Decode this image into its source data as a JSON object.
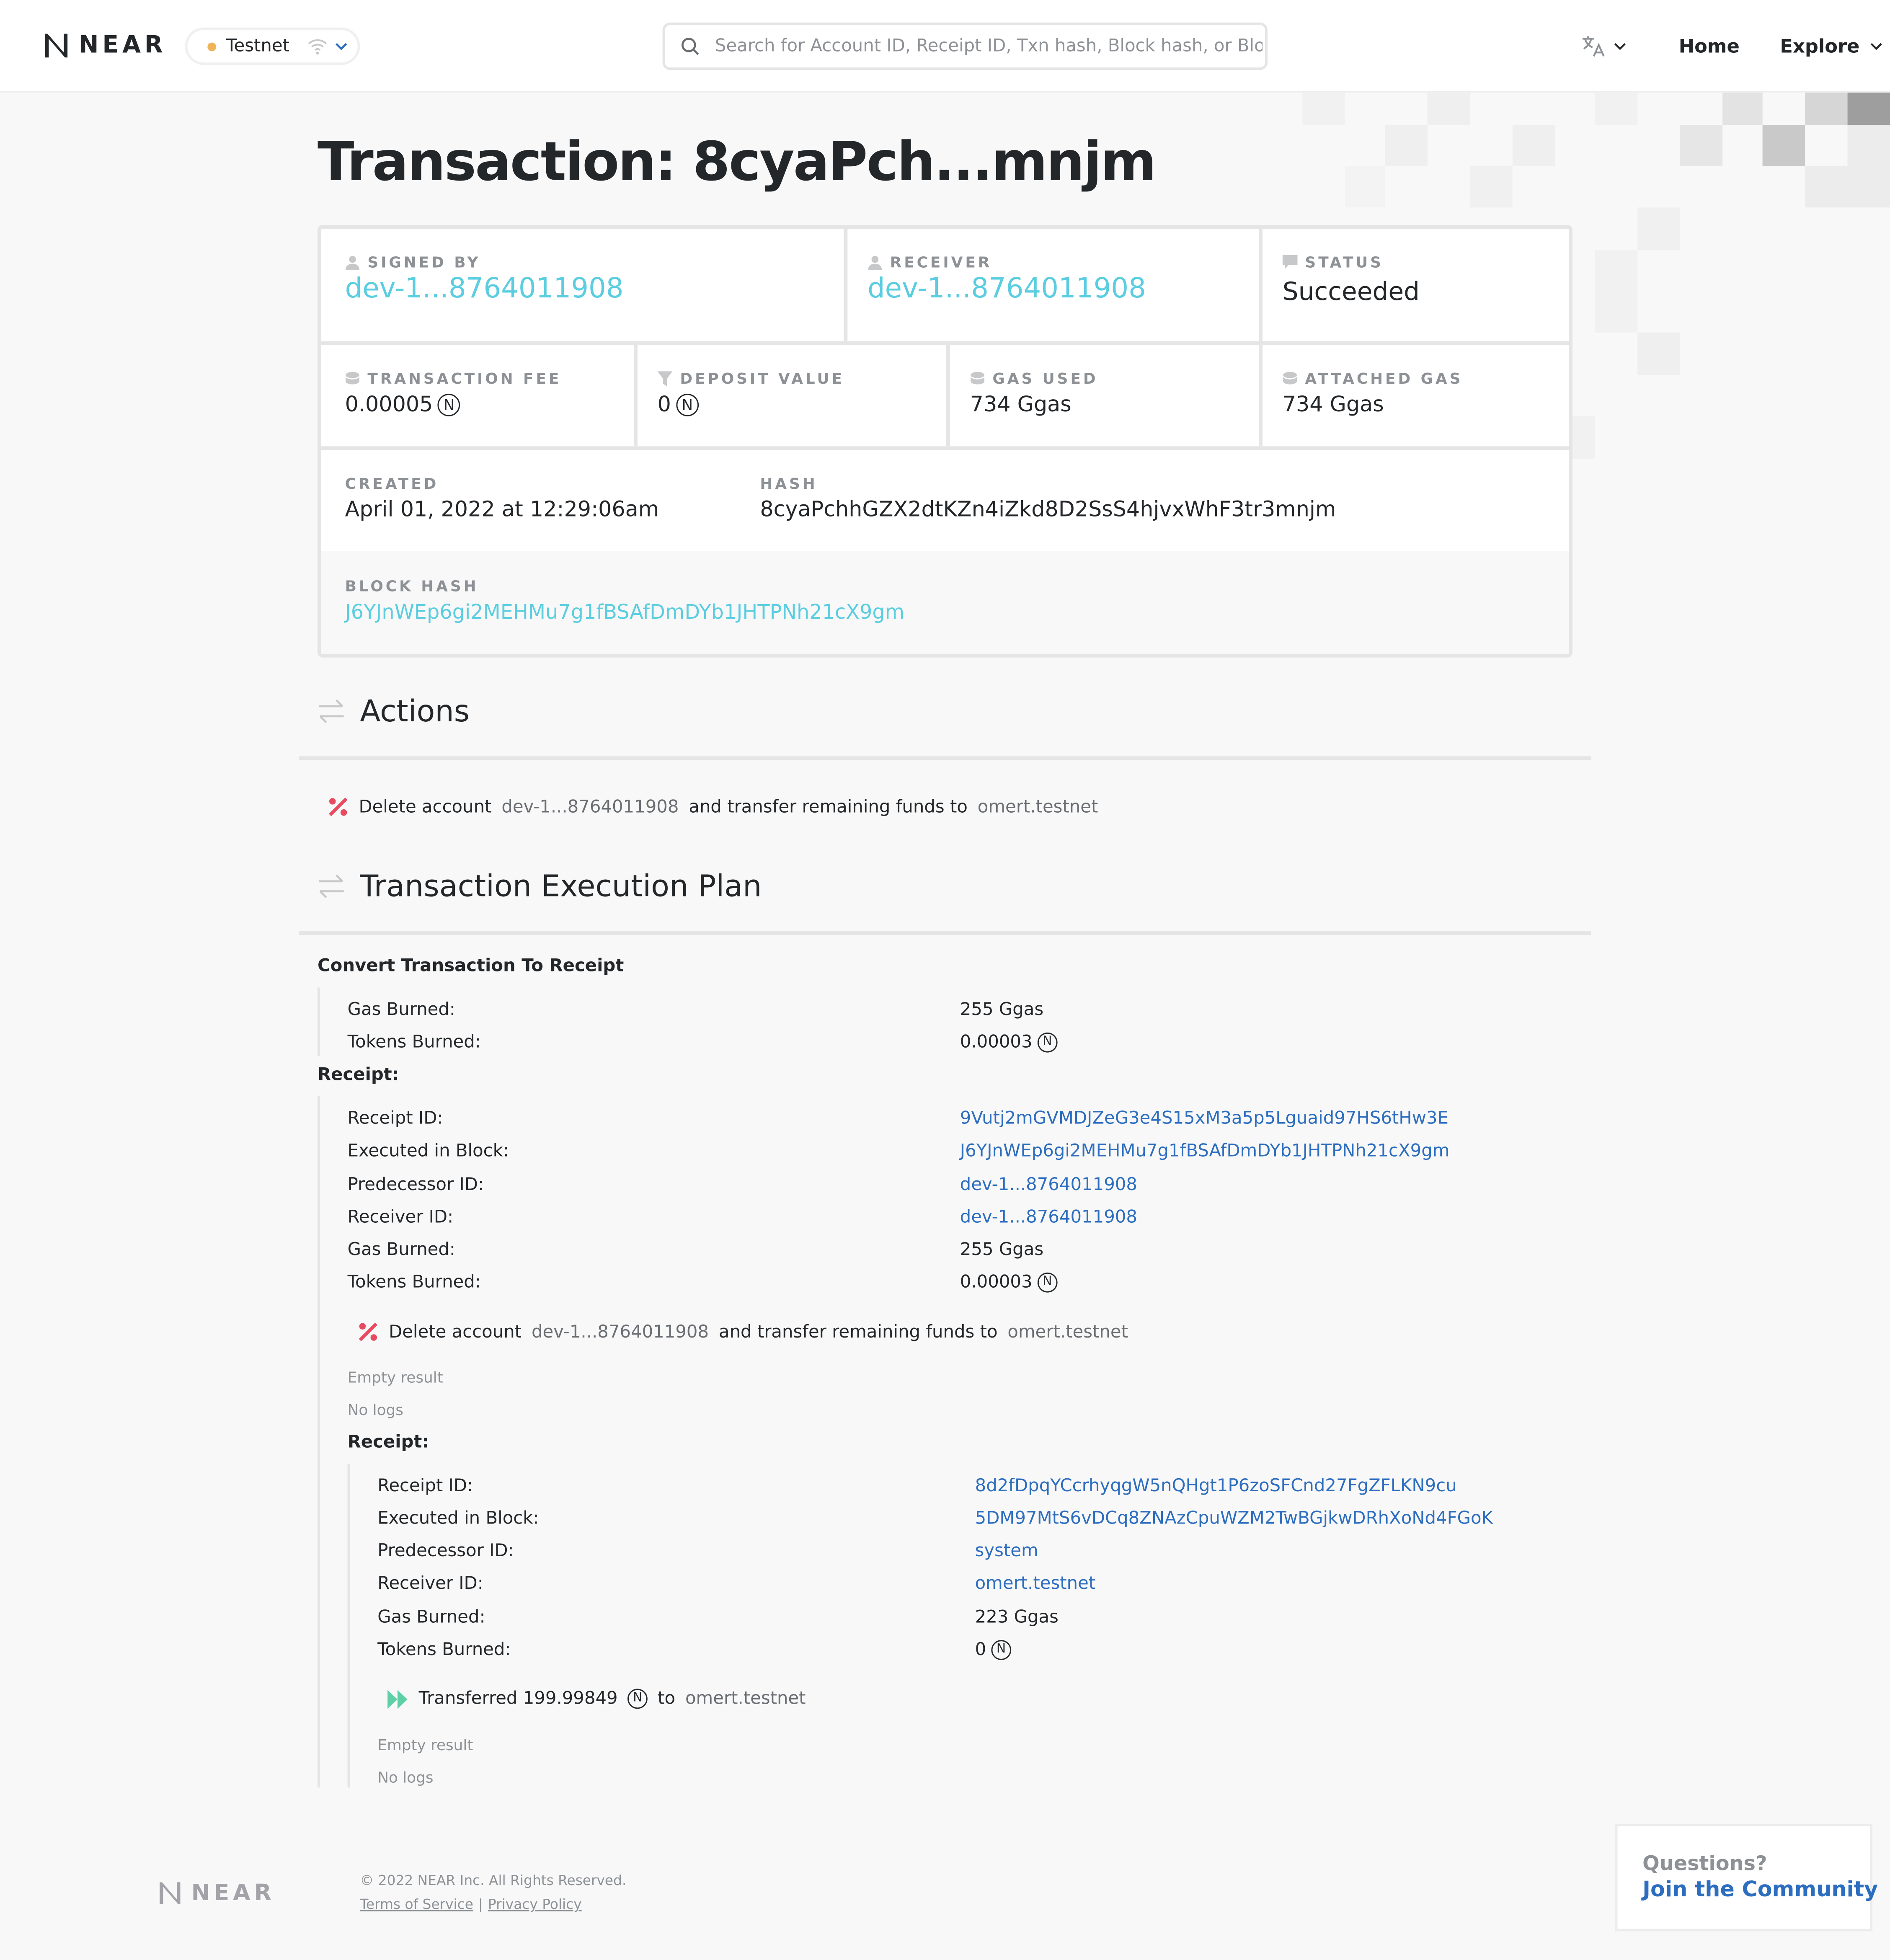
{
  "header": {
    "brand": "NEAR",
    "network": "Testnet",
    "search_placeholder": "Search for Account ID, Receipt ID, Txn hash, Block hash, or Block height",
    "nav_home": "Home",
    "nav_explore": "Explore"
  },
  "page": {
    "title": "Transaction: 8cyaPch...mnjm"
  },
  "summary": {
    "signed_by_label": "SIGNED BY",
    "signed_by": "dev-1...8764011908",
    "receiver_label": "RECEIVER",
    "receiver": "dev-1...8764011908",
    "status_label": "STATUS",
    "status": "Succeeded",
    "fee_label": "TRANSACTION FEE",
    "fee": "0.00005",
    "deposit_label": "DEPOSIT VALUE",
    "deposit": "0",
    "gas_used_label": "GAS USED",
    "gas_used": "734 Ggas",
    "attached_gas_label": "ATTACHED GAS",
    "attached_gas": "734 Ggas",
    "created_label": "CREATED",
    "created": "April 01, 2022 at 12:29:06am",
    "hash_label": "HASH",
    "hash": "8cyaPchhGZX2dtKZn4iZkd8D2SsS4hjvxWhF3tr3mnjm",
    "block_hash_label": "BLOCK HASH",
    "block_hash": "J6YJnWEp6gi2MEHMu7g1fBSAfDmDYb1JHTPNh21cX9gm"
  },
  "actions": {
    "heading": "Actions",
    "item": {
      "prefix": "Delete account",
      "account": "dev-1...8764011908",
      "middle": "and transfer remaining funds to",
      "beneficiary": "omert.testnet"
    }
  },
  "plan": {
    "heading": "Transaction Execution Plan",
    "convert_label": "Convert Transaction To Receipt",
    "convert": {
      "gas_burned_label": "Gas Burned:",
      "gas_burned": "255 Ggas",
      "tokens_burned_label": "Tokens Burned:",
      "tokens_burned": "0.00003"
    },
    "receipt_label": "Receipt:",
    "receipt1": {
      "receipt_id_label": "Receipt ID:",
      "receipt_id": "9Vutj2mGVMDJZeG3e4S15xM3a5p5Lguaid97HS6tHw3E",
      "block_label": "Executed in Block:",
      "block": "J6YJnWEp6gi2MEHMu7g1fBSAfDmDYb1JHTPNh21cX9gm",
      "predecessor_label": "Predecessor ID:",
      "predecessor": "dev-1...8764011908",
      "receiver_label": "Receiver ID:",
      "receiver": "dev-1...8764011908",
      "gas_burned_label": "Gas Burned:",
      "gas_burned": "255 Ggas",
      "tokens_burned_label": "Tokens Burned:",
      "tokens_burned": "0.00003",
      "action_prefix": "Delete account",
      "action_account": "dev-1...8764011908",
      "action_middle": "and transfer remaining funds to",
      "action_beneficiary": "omert.testnet",
      "result": "Empty result",
      "logs": "No logs"
    },
    "receipt2": {
      "receipt_id_label": "Receipt ID:",
      "receipt_id": "8d2fDpqYCcrhyqgW5nQHgt1P6zoSFCnd27FgZFLKN9cu",
      "block_label": "Executed in Block:",
      "block": "5DM97MtS6vDCq8ZNAzCpuWZM2TwBGjkwDRhXoNd4FGoK",
      "predecessor_label": "Predecessor ID:",
      "predecessor": "system",
      "receiver_label": "Receiver ID:",
      "receiver": "omert.testnet",
      "gas_burned_label": "Gas Burned:",
      "gas_burned": "223 Ggas",
      "tokens_burned_label": "Tokens Burned:",
      "tokens_burned": "0",
      "transfer_prefix": "Transferred 199.99849",
      "transfer_to": "to",
      "transfer_target": "omert.testnet",
      "result": "Empty result",
      "logs": "No logs"
    }
  },
  "footer": {
    "brand": "NEAR",
    "copyright": "© 2022 NEAR Inc. All Rights Reserved.",
    "terms": "Terms of Service",
    "separator": "|",
    "privacy": "Privacy Policy",
    "help_question": "Questions?",
    "help_link": "Join the Community"
  },
  "icons": {
    "near_token_glyph": "N",
    "colors": {
      "link_teal": "#5acde0",
      "link_blue": "#2c6dbf",
      "delete_red": "#e84a5f",
      "transfer_green": "#5fcfa7",
      "network_dot": "#f0b357"
    }
  }
}
